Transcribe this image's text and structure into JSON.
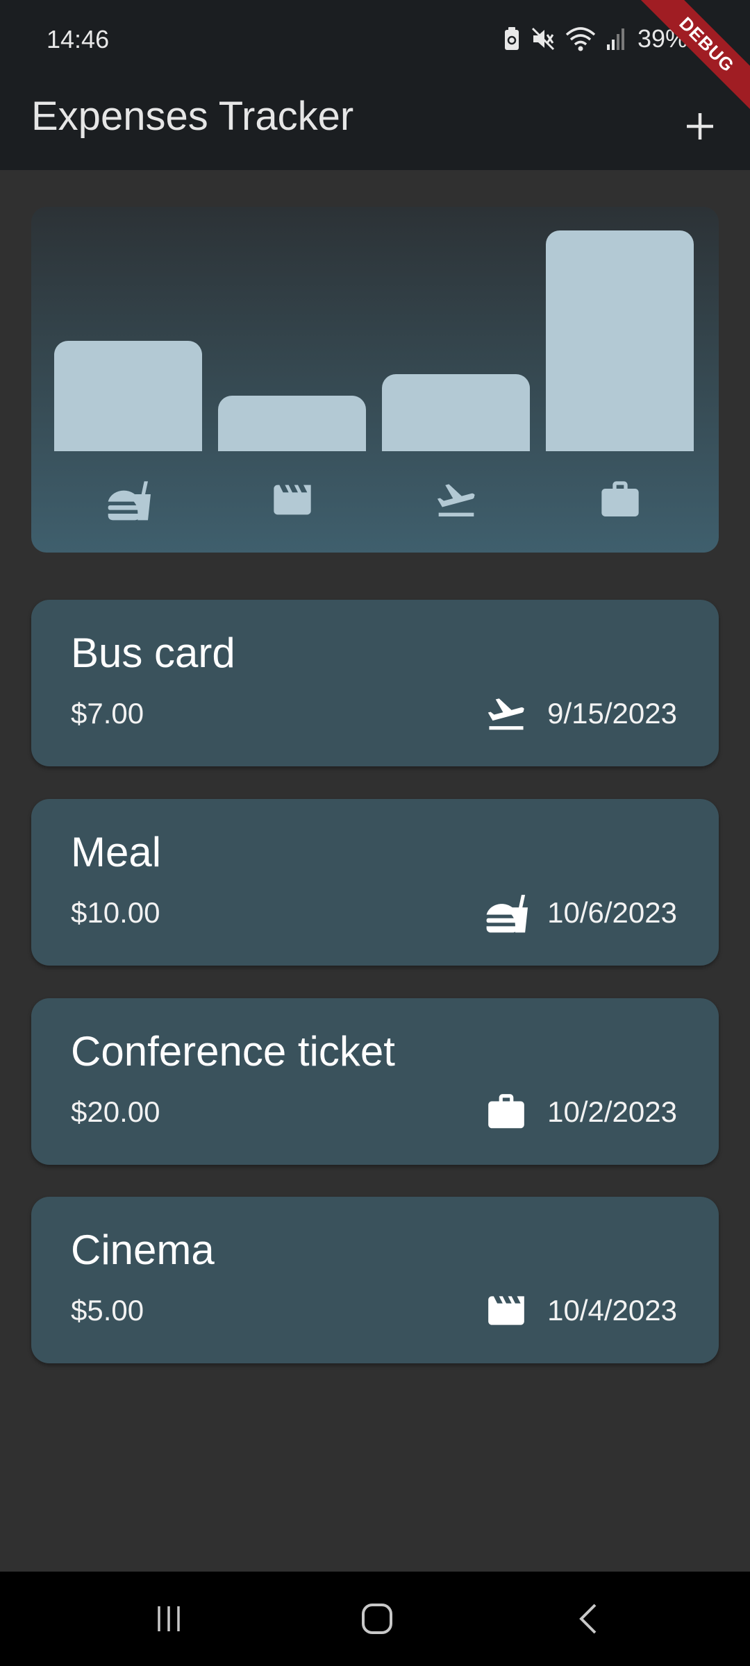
{
  "status": {
    "time": "14:46",
    "battery": "39%",
    "debug_label": "DEBUG"
  },
  "app": {
    "title": "Expenses Tracker",
    "add_icon": "plus-icon"
  },
  "chart_data": {
    "type": "bar",
    "categories": [
      "food",
      "leisure",
      "travel",
      "work"
    ],
    "category_icons": [
      "fastfood-icon",
      "movie-icon",
      "flight-takeoff-icon",
      "work-icon"
    ],
    "values": [
      10,
      5,
      7,
      20
    ],
    "bar_color": "#b3c9d4"
  },
  "expenses": [
    {
      "title": "Bus card",
      "amount": "$7.00",
      "date": "9/15/2023",
      "category_icon": "flight-takeoff-icon"
    },
    {
      "title": "Meal",
      "amount": "$10.00",
      "date": "10/6/2023",
      "category_icon": "fastfood-icon"
    },
    {
      "title": "Conference ticket",
      "amount": "$20.00",
      "date": "10/2/2023",
      "category_icon": "work-icon"
    },
    {
      "title": "Cinema",
      "amount": "$5.00",
      "date": "10/4/2023",
      "category_icon": "movie-icon"
    }
  ],
  "colors": {
    "card": "#3a525c",
    "app_bar": "#1b1e21",
    "background": "#303030"
  },
  "nav": {
    "recents_icon": "recents-icon",
    "home_icon": "home-icon",
    "back_icon": "back-icon"
  }
}
